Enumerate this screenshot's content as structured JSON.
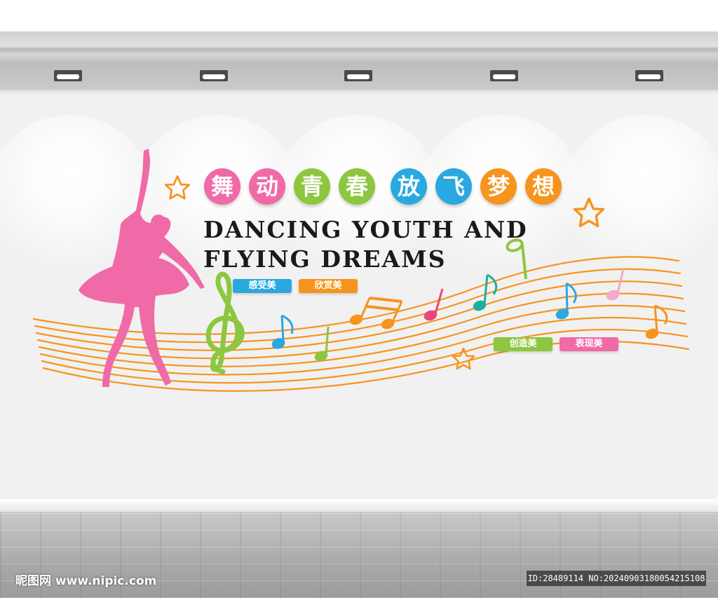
{
  "title_cn": {
    "chars": [
      "舞",
      "动",
      "青",
      "春",
      "放",
      "飞",
      "梦",
      "想"
    ],
    "colors": [
      "#f06aa8",
      "#f06aa8",
      "#8dc63f",
      "#8dc63f",
      "#2aa8e0",
      "#2aa8e0",
      "#f7941d",
      "#f7941d"
    ]
  },
  "title_en": {
    "line1": "DANCING YOUTH AND",
    "line2": "FLYING DREAMS"
  },
  "tags": {
    "feel": "感受美",
    "appreciate": "欣赏美",
    "create": "创造美",
    "express": "表现美"
  },
  "colors": {
    "pink": "#f06aa8",
    "green": "#8dc63f",
    "blue": "#2aa8e0",
    "orange": "#f7941d",
    "staff": "#f7941d",
    "text": "#1a1a1a"
  },
  "icons": [
    "dancer-silhouette",
    "treble-clef-icon",
    "star-icon",
    "music-note-icon",
    "ceiling-lamp-icon"
  ],
  "watermark": {
    "site": "昵图网 www.nipic.com",
    "id_text": "ID:28489114 NO:20240903180054215108"
  }
}
